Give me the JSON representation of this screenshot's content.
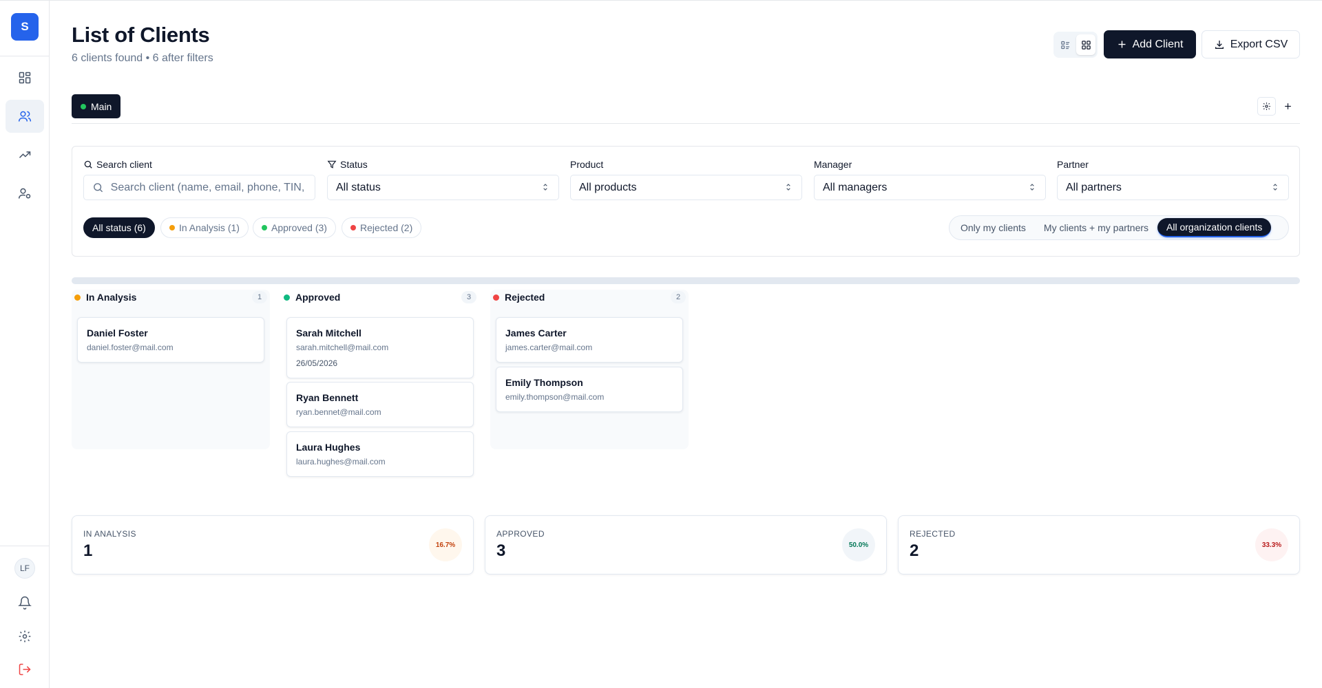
{
  "sidebar": {
    "logo_letter": "S",
    "nav": [
      {
        "icon": "dashboard-icon"
      },
      {
        "icon": "users-icon",
        "active": true
      },
      {
        "icon": "trending-up-icon"
      },
      {
        "icon": "user-settings-icon"
      }
    ],
    "avatar_initials": "LF",
    "bottom": [
      {
        "icon": "bell-icon"
      },
      {
        "icon": "gear-icon"
      },
      {
        "icon": "logout-icon"
      }
    ]
  },
  "header": {
    "title": "List of Clients",
    "subtitle": "6 clients found • 6 after filters",
    "add_label": "Add Client",
    "export_label": "Export CSV"
  },
  "tabs": {
    "main_label": "Main"
  },
  "filters": {
    "search_label": "Search client",
    "search_placeholder": "Search client (name, email, phone, TIN, ...)",
    "status_label": "Status",
    "status_value": "All status",
    "product_label": "Product",
    "product_value": "All products",
    "manager_label": "Manager",
    "manager_value": "All managers",
    "partner_label": "Partner",
    "partner_value": "All partners",
    "chips": [
      {
        "label": "All status (6)",
        "active": true
      },
      {
        "label": "In Analysis (1)",
        "color": "#f59e0b"
      },
      {
        "label": "Approved (3)",
        "color": "#22c55e"
      },
      {
        "label": "Rejected (2)",
        "color": "#ef4444"
      }
    ],
    "scope": [
      {
        "label": "Only my clients"
      },
      {
        "label": "My clients + my partners"
      },
      {
        "label": "All organization clients",
        "active": true
      }
    ]
  },
  "kanban": {
    "columns": [
      {
        "title": "In Analysis",
        "count": "1",
        "color": "#f59e0b",
        "cards": [
          {
            "name": "Daniel Foster",
            "email": "daniel.foster@mail.com"
          }
        ]
      },
      {
        "title": "Approved",
        "count": "3",
        "color": "#10b981",
        "cards": [
          {
            "name": "Sarah Mitchell",
            "email": "sarah.mitchell@mail.com",
            "date": "26/05/2026"
          },
          {
            "name": "Ryan Bennett",
            "email": "ryan.bennet@mail.com"
          },
          {
            "name": "Laura Hughes",
            "email": "laura.hughes@mail.com"
          }
        ]
      },
      {
        "title": "Rejected",
        "count": "2",
        "color": "#ef4444",
        "cards": [
          {
            "name": "James Carter",
            "email": "james.carter@mail.com"
          },
          {
            "name": "Emily Thompson",
            "email": "emily.thompson@mail.com"
          }
        ]
      }
    ]
  },
  "stats": [
    {
      "label": "IN ANALYSIS",
      "value": "1",
      "percent": "16.7%",
      "color": "#c2410c",
      "bg": "#fff7ed"
    },
    {
      "label": "APPROVED",
      "value": "3",
      "percent": "50.0%",
      "color": "#047857",
      "bg": "#f1f5f9"
    },
    {
      "label": "REJECTED",
      "value": "2",
      "percent": "33.3%",
      "color": "#b91c1c",
      "bg": "#fef2f2"
    }
  ]
}
